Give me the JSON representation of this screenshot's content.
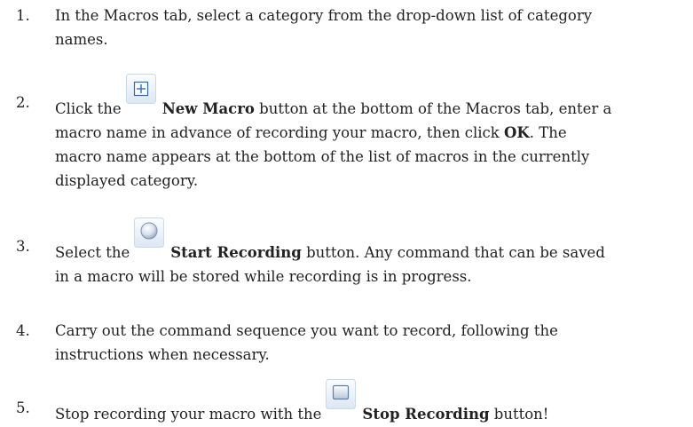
{
  "steps": [
    {
      "number": "1.",
      "lines": [
        [
          "In the Macros tab, select a category from the drop-down list of category"
        ],
        [
          "names."
        ]
      ]
    },
    {
      "number": "2.",
      "icon": "plus-box-icon",
      "pre": "Click the",
      "bold": "New Macro",
      "post": "button at the bottom of the Macros tab, enter a",
      "line2": "macro name in advance of recording your macro, then click",
      "line2_bold": "OK",
      "line2_post": ". The",
      "line3": "macro name appears at the bottom of the list of macros in the currently",
      "line4": "displayed category."
    },
    {
      "number": "3.",
      "icon": "record-circle-icon",
      "pre": "Select the",
      "bold": "Start Recording",
      "post": "button. Any command that can be saved",
      "line2": "in a macro will be stored while recording is in progress."
    },
    {
      "number": "4.",
      "line1": "Carry out the command sequence you want to record, following the",
      "line2": "instructions when necessary."
    },
    {
      "number": "5.",
      "icon": "stop-square-icon",
      "pre": "Stop recording your macro with the",
      "bold": "Stop Recording",
      "post": "button!"
    }
  ]
}
